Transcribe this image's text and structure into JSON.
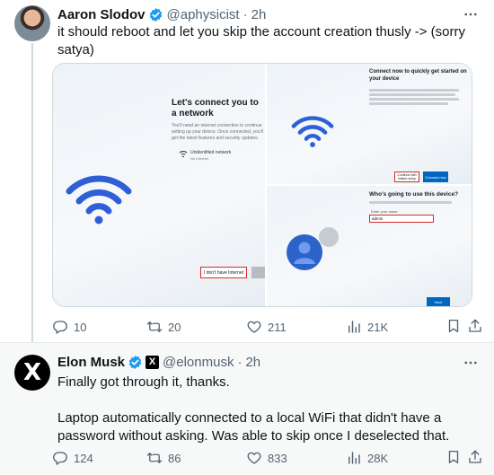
{
  "tweets": [
    {
      "author": "Aaron Slodov",
      "handle": "@aphysicist",
      "separator": "·",
      "time": "2h",
      "text": "it should reboot and let you skip the account creation thusly -> (sorry satya)",
      "media": {
        "left": {
          "title": "Let's connect you to a network",
          "subtitle": "You'll need an internet connection to continue setting up your device. Once connected, you'll get the latest features and security updates.",
          "network_name": "Unidentified network",
          "network_status": "No Internet",
          "button": "I don't have Internet"
        },
        "top_right": {
          "title": "Connect now to quickly get started on your device",
          "button_red": "Continue with limited setup",
          "button_blue": "Connect now"
        },
        "bottom_right": {
          "title": "Who's going to use this device?",
          "field_label": "Enter your name",
          "field_value": "admin",
          "button": "Next"
        }
      },
      "stats": {
        "replies": "10",
        "reposts": "20",
        "likes": "211",
        "views": "21K"
      }
    },
    {
      "author": "Elon Musk",
      "handle": "@elonmusk",
      "separator": "·",
      "time": "2h",
      "affiliate": "X",
      "avatar_letter": "X",
      "text": "Finally got through it, thanks.\n\nLaptop automatically connected to a local WiFi that didn't have a password without asking. Was able to skip once I deselected that.",
      "stats": {
        "replies": "124",
        "reposts": "86",
        "likes": "833",
        "views": "28K"
      }
    }
  ],
  "colors": {
    "verified": "#1d9bf0",
    "muted": "#536471",
    "text": "#0f1419",
    "wifi": "#2f5fd6"
  }
}
